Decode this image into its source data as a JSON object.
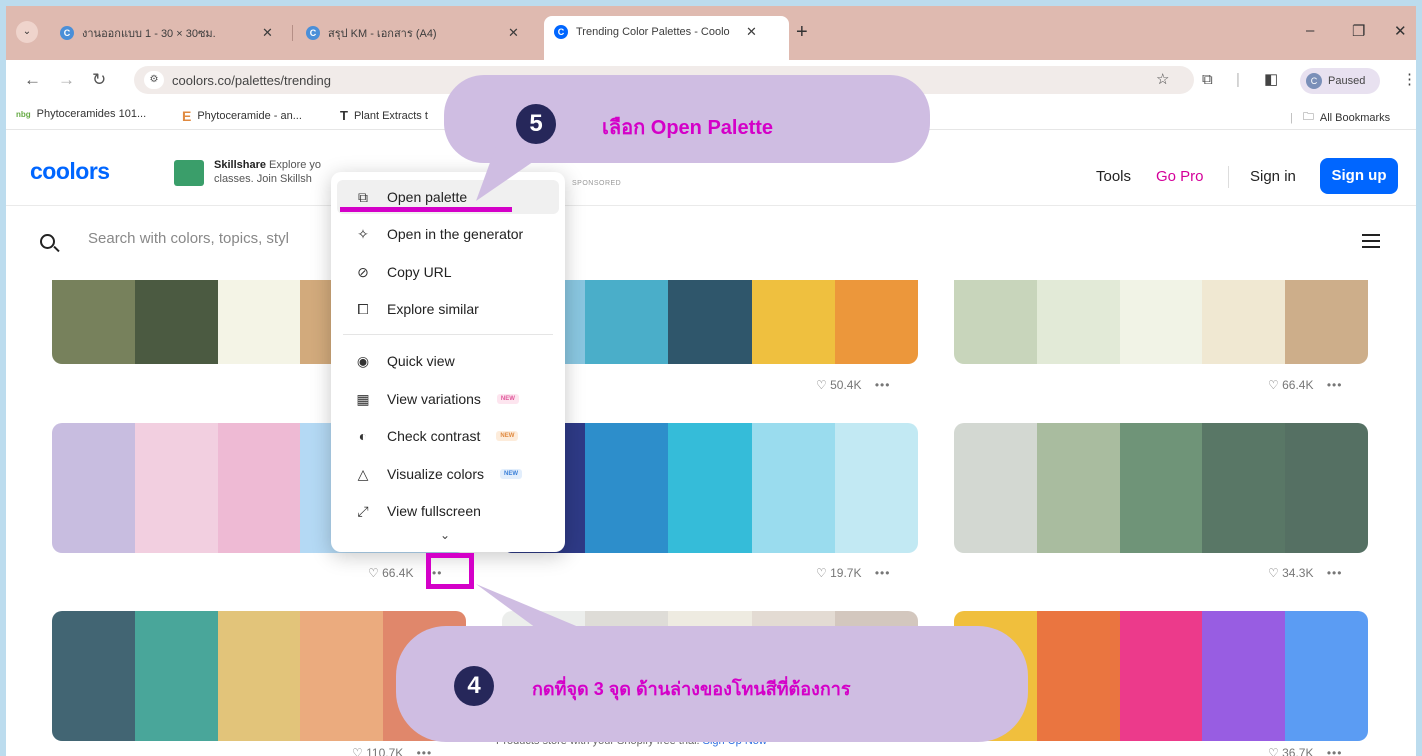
{
  "browser": {
    "tabs": [
      {
        "label": "งานออกแบบ 1 - 30 × 30ซม.",
        "favicon_color": "#4a8fd8"
      },
      {
        "label": "สรุป KM - เอกสาร (A4)",
        "favicon_color": "#4a8fd8"
      },
      {
        "label": "Trending Color Palettes - Coolo",
        "favicon_color": "#0066ff",
        "active": true
      }
    ],
    "new_tab": "+",
    "url": "coolors.co/palettes/trending",
    "profile": {
      "initial": "C",
      "label": "Paused"
    },
    "bookmarks": [
      "Phytoceramides 101...",
      "Phytoceramide - an...",
      "Plant Extracts t"
    ],
    "bookmark_icons": [
      "nbg",
      "E",
      "T"
    ],
    "all_bookmarks": "All Bookmarks"
  },
  "site": {
    "logo": "coolors",
    "ad": {
      "brand": "Skillshare",
      "line1": "Explore yo",
      "line2": "classes. Join Skillsh",
      "sponsored": "SPONSORED"
    },
    "nav": {
      "tools": "Tools",
      "go_pro": "Go Pro",
      "sign_in": "Sign in",
      "sign_up": "Sign up"
    },
    "search": {
      "placeholder": "Search with colors, topics, styl"
    }
  },
  "palettes": [
    {
      "colors": [
        "#77815c",
        "#4b5a41",
        "#f4f4e6",
        "#d2aa7c",
        "#d2aa7c"
      ],
      "likes": ""
    },
    {
      "colors": [
        "#89c6e0",
        "#4aaec9",
        "#2f566b",
        "#efc03f",
        "#ec973b"
      ],
      "likes": "50.4K"
    },
    {
      "colors": [
        "#c8d5bb",
        "#e2ead7",
        "#f1f3e6",
        "#f0e8d2",
        "#cdae8a"
      ],
      "likes": "66.4K"
    },
    {
      "colors": [
        "#c8bde0",
        "#f2cfe0",
        "#eebad4",
        "#b4d9f4",
        "#b4d9f4"
      ],
      "likes": "66.4K"
    },
    {
      "colors": [
        "#2e3a86",
        "#2d8ecb",
        "#35bcd9",
        "#9adcee",
        "#c2e9f3"
      ],
      "likes": "19.7K"
    },
    {
      "colors": [
        "#d3d8d2",
        "#a9bc9f",
        "#6f9478",
        "#597766",
        "#557063"
      ],
      "likes": "34.3K"
    },
    {
      "colors": [
        "#426573",
        "#49a69a",
        "#e2c47a",
        "#ebab7e",
        "#e0876b"
      ],
      "likes": "110.7K"
    },
    {
      "colors": [
        "#eceeec",
        "#dedcd7",
        "#eeebe1",
        "#e3dbd3",
        "#d3c7be"
      ],
      "likes": ""
    },
    {
      "colors": [
        "#f0bf3d",
        "#ea7540",
        "#ec3a8b",
        "#985de2",
        "#5b9cf3"
      ],
      "likes": "36.7K"
    }
  ],
  "more_dots": "•••",
  "shopify": {
    "text": "Products store with your Shopify free trial.",
    "link": "Sign Up Now"
  },
  "menu": {
    "items": [
      {
        "label": "Open palette",
        "icon": "external-link-icon"
      },
      {
        "label": "Open in the generator",
        "icon": "magic-wand-icon"
      },
      {
        "label": "Copy URL",
        "icon": "link-icon"
      },
      {
        "label": "Explore similar",
        "icon": "copy-icon"
      },
      {
        "label": "Quick view",
        "icon": "eye-icon"
      },
      {
        "label": "View variations",
        "icon": "grid-icon",
        "badge": "NEW"
      },
      {
        "label": "Check contrast",
        "icon": "contrast-icon",
        "badge": "NEW"
      },
      {
        "label": "Visualize colors",
        "icon": "shapes-icon",
        "badge": "NEW"
      },
      {
        "label": "View fullscreen",
        "icon": "fullscreen-icon"
      }
    ]
  },
  "annotations": [
    {
      "number": "5",
      "text": "เลือก Open Palette"
    },
    {
      "number": "4",
      "text": "กดที่จุด 3 จุด ด้านล่างของโทนสีที่ต้องการ"
    }
  ],
  "colors": {
    "accent": "#0066ff",
    "go_pro": "#d4009a",
    "highlight": "#d400c8",
    "callout": "#cfbde2"
  }
}
